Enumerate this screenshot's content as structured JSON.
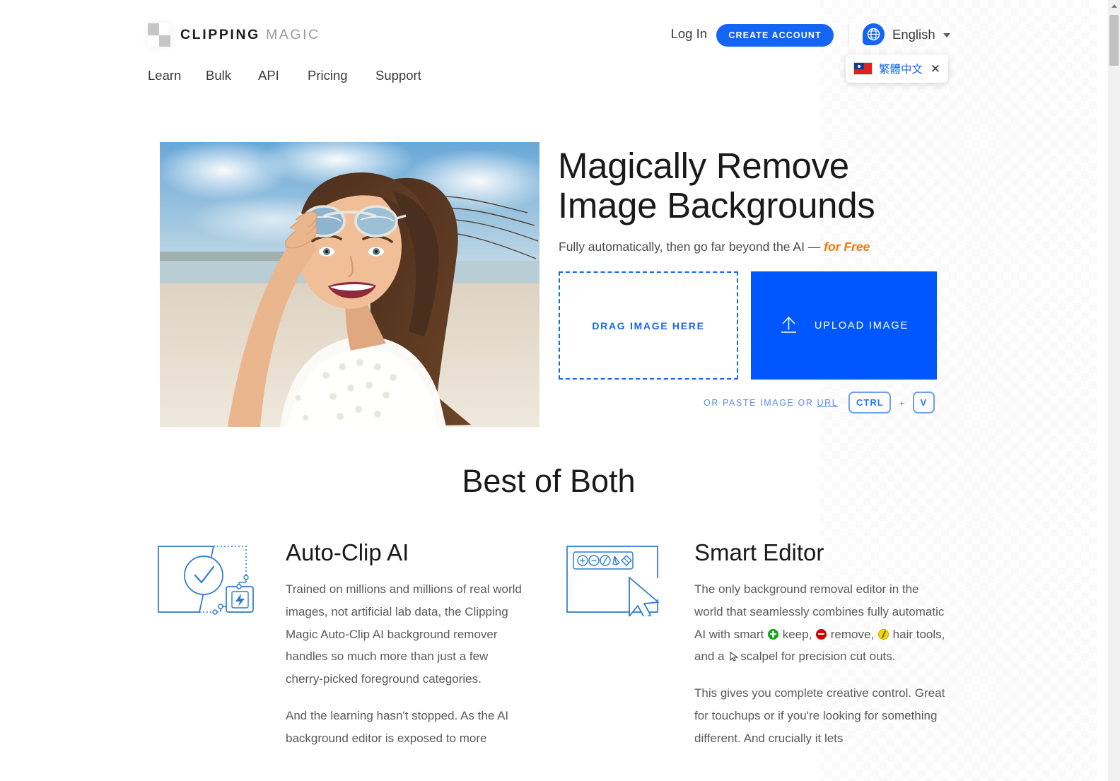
{
  "header": {
    "logo": {
      "strong": "CLIPPING",
      "light": "MAGIC",
      "icon": "checkerboard-logo-icon"
    },
    "nav": [
      {
        "label": "Learn"
      },
      {
        "label": "Bulk"
      },
      {
        "label": "API"
      },
      {
        "label": "Pricing"
      },
      {
        "label": "Support"
      }
    ],
    "login_label": "Log In",
    "create_account_label": "CREATE ACCOUNT",
    "language": {
      "icon": "globe-speech-bubble-icon",
      "current": "English",
      "caret": "chevron-down-icon"
    },
    "language_popup": {
      "flag": "taiwan-flag-icon",
      "label": "繁體中文",
      "close": "✕"
    }
  },
  "hero": {
    "photo_alt": "woman-on-beach-with-sunglasses",
    "title_line1": "Magically Remove",
    "title_line2": "Image Backgrounds",
    "subtitle_prefix": "Fully automatically, then go far beyond the AI — ",
    "subtitle_highlight": "for Free",
    "dropzone_label": "DRAG IMAGE HERE",
    "upload_label": "UPLOAD IMAGE",
    "upload_icon": "upload-arrow-icon",
    "paste_prefix": "OR PASTE IMAGE OR ",
    "paste_url_label": "URL",
    "key_ctrl": "CTRL",
    "key_plus": "+",
    "key_v": "V"
  },
  "best_of_both": {
    "section_title": "Best of Both",
    "features": [
      {
        "icon": "auto-clip-ai-icon",
        "title": "Auto-Clip AI",
        "paragraph1": "Trained on millions and millions of real world images, not artificial lab data, the Clipping Magic Auto-Clip AI background remover handles so much more than just a few cherry-picked foreground categories.",
        "paragraph2": "And the learning hasn't stopped. As the AI background editor is exposed to more"
      },
      {
        "icon": "smart-editor-icon",
        "title": "Smart Editor",
        "paragraph1_a": "The only background removal editor in the world that seamlessly combines fully automatic AI with smart ",
        "paragraph1_keep": "keep,",
        "paragraph1_remove": "remove,",
        "paragraph1_hair": "hair tools, and a ",
        "paragraph1_scalpel": "scalpel for precision cut outs.",
        "paragraph2": "This gives you complete creative control. Great for touchups or if you're looking for something different. And crucially it lets"
      }
    ]
  },
  "colors": {
    "brand_blue": "#0057ff",
    "button_blue": "#1565f5",
    "orange": "#f07800",
    "keep_green": "#13a313",
    "remove_red": "#c80000",
    "hair_yellow": "#f2d900"
  },
  "scrollbar": {
    "up_arrow": "scroll-up-arrow-icon"
  }
}
